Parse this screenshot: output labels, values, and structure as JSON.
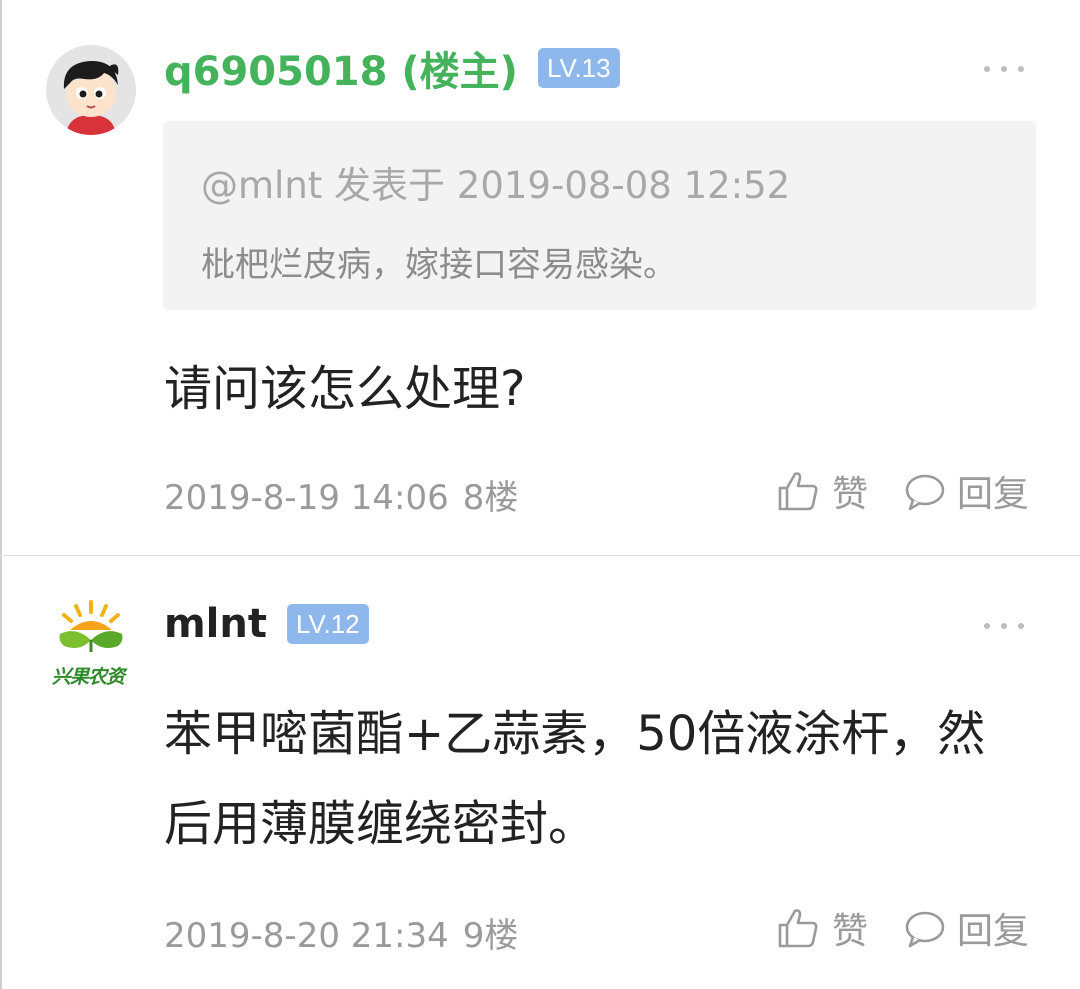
{
  "posts": [
    {
      "username": "q6905018 (楼主)",
      "level": "LV.13",
      "avatar_icon": "cartoon-boy-avatar",
      "quote": {
        "meta": "@mlnt 发表于 2019-08-08 12:52",
        "text": "枇杷烂皮病，嫁接口容易感染。"
      },
      "content": "请问该怎么处理?",
      "time": "2019-8-19 14:06",
      "floor": "8楼",
      "like_label": "赞",
      "reply_label": "回复"
    },
    {
      "username": "mlnt",
      "level": "LV.12",
      "avatar_icon": "xingguo-nongzi-logo",
      "avatar_logo_text": "兴果农资",
      "content": "苯甲嘧菌酯+乙蒜素，50倍液涂杆，然后用薄膜缠绕密封。",
      "time": "2019-8-20 21:34",
      "floor": "9楼",
      "like_label": "赞",
      "reply_label": "回复"
    }
  ],
  "colors": {
    "op_username": "#45b25c",
    "level_badge": "#8eb8ec",
    "meta_gray": "#9a9a9a",
    "quote_bg": "#f3f3f3"
  }
}
